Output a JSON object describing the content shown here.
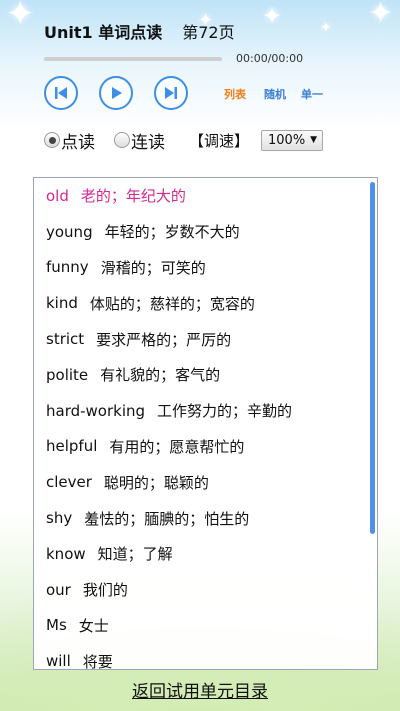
{
  "header": {
    "title": "Unit1 单词点读",
    "page": "第72页"
  },
  "player": {
    "time": "00:00/00:00",
    "progress": 0,
    "modes": {
      "list": "列表",
      "random": "随机",
      "single": "单一"
    },
    "icons": {
      "prev": "skip-previous-icon",
      "play": "play-icon",
      "next": "skip-next-icon"
    }
  },
  "options": {
    "mode_point": "点读",
    "mode_continuous": "连读",
    "mode_selected": "点读",
    "speed_label": "【调速】",
    "speed_value": "100%"
  },
  "words": [
    {
      "word": "old",
      "meaning": "老的；年纪大的",
      "active": true
    },
    {
      "word": "young",
      "meaning": "年轻的；岁数不大的"
    },
    {
      "word": "funny",
      "meaning": "滑稽的；可笑的"
    },
    {
      "word": "kind",
      "meaning": "体贴的；慈祥的；宽容的"
    },
    {
      "word": "strict",
      "meaning": "要求严格的；严厉的"
    },
    {
      "word": "polite",
      "meaning": "有礼貌的；客气的"
    },
    {
      "word": "hard-working",
      "meaning": "工作努力的；辛勤的"
    },
    {
      "word": "helpful",
      "meaning": "有用的；愿意帮忙的"
    },
    {
      "word": "clever",
      "meaning": "聪明的；聪颖的"
    },
    {
      "word": "shy",
      "meaning": "羞怯的；腼腆的；怕生的"
    },
    {
      "word": "know",
      "meaning": "知道；了解"
    },
    {
      "word": "our",
      "meaning": "我们的"
    },
    {
      "word": "Ms",
      "meaning": "女士"
    },
    {
      "word": "will",
      "meaning": "将要"
    }
  ],
  "footer": {
    "back_link": "返回试用单元目录"
  },
  "colors": {
    "accent_blue": "#3d8ee6",
    "list_mode_orange": "#ef7d1b",
    "active_word_pink": "#d6298f"
  }
}
